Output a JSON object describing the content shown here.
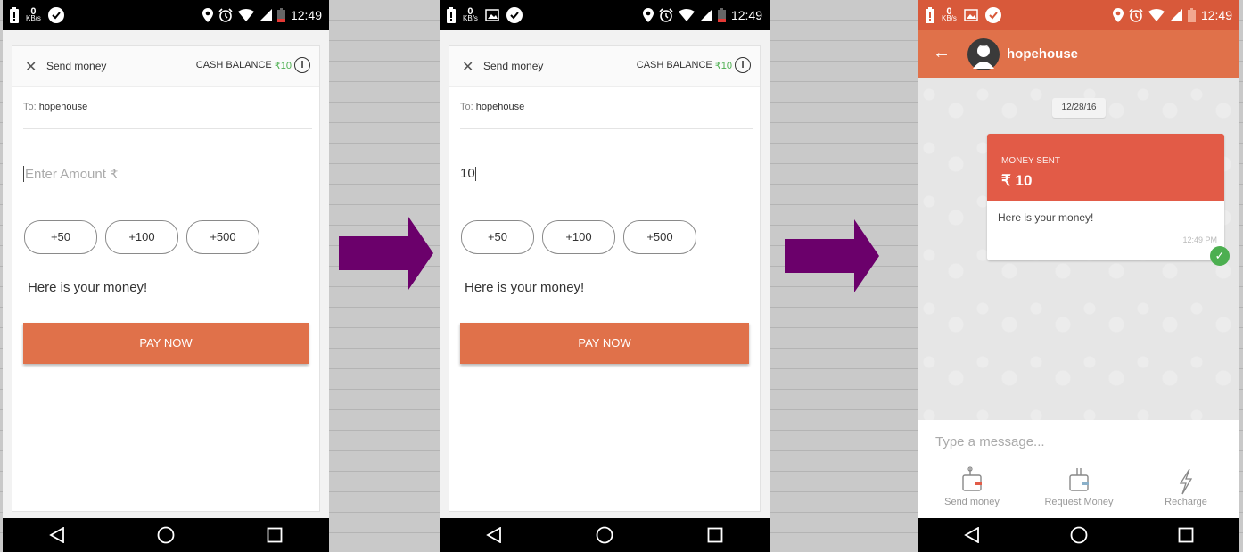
{
  "status_bar": {
    "time": "12:49",
    "net_speed_value": "0",
    "net_speed_unit": "KB/s"
  },
  "send_screen": {
    "title": "Send money",
    "cash_balance_label": "CASH BALANCE",
    "cash_balance_value": "₹10",
    "info_icon": "i",
    "to_label": "To:",
    "to_value": "hopehouse",
    "amount_placeholder": "Enter Amount ₹",
    "amount_value": "10",
    "quick_amounts": [
      "+50",
      "+100",
      "+500"
    ],
    "note": "Here is your money!",
    "pay_label": "PAY NOW"
  },
  "chat_screen": {
    "contact_name": "hopehouse",
    "date": "12/28/16",
    "bubble_label": "MONEY SENT",
    "bubble_amount": "₹ 10",
    "bubble_message": "Here is your money!",
    "bubble_time": "12:49 PM",
    "message_placeholder": "Type a message...",
    "actions": [
      "Send money",
      "Request Money",
      "Recharge"
    ]
  },
  "colors": {
    "accent": "#e0714a",
    "money_sent": "#e25b47",
    "balance_green": "#4caf50",
    "arrow_purple": "#6b006b"
  }
}
